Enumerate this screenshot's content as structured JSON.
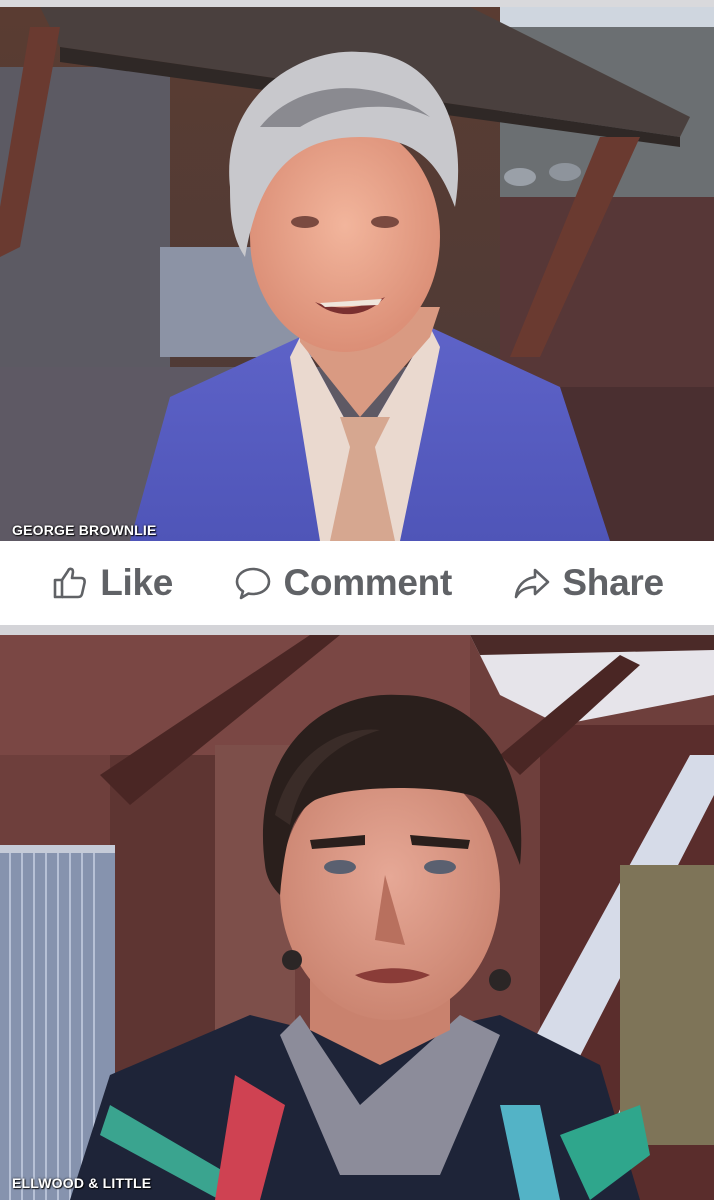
{
  "top_video": {
    "caption": "GEORGE BROWNLIE"
  },
  "actions": {
    "like_label": "Like",
    "comment_label": "Comment",
    "share_label": "Share",
    "like_icon": "thumbs-up-icon",
    "comment_icon": "speech-bubble-icon",
    "share_icon": "share-arrow-icon"
  },
  "bottom_video": {
    "caption": "ELLWOOD & LITTLE"
  },
  "colors": {
    "action_text": "#606266",
    "action_bar_bg": "#ffffff",
    "divider": "#d4d4d8"
  }
}
